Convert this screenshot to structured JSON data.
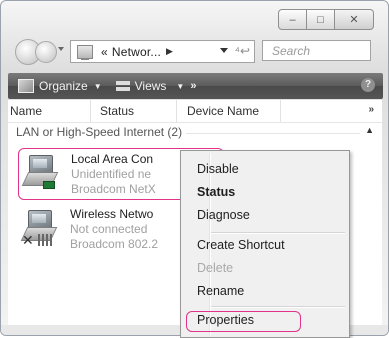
{
  "window": {
    "captions": {
      "minimize": "–",
      "maximize": "□",
      "close": "✕"
    }
  },
  "address_bar": {
    "breadcrumb_prefix": "«",
    "path": "Networ...",
    "path_arrow": "▶",
    "refresh_icon": "refresh-icon"
  },
  "search": {
    "placeholder": "Search"
  },
  "toolbar": {
    "organize_label": "Organize",
    "views_label": "Views",
    "more_label": "»",
    "help_label": "?",
    "bg_color": "#5b5b5b"
  },
  "columns": {
    "name": "Name",
    "status": "Status",
    "device": "Device Name",
    "more": "»"
  },
  "group": {
    "label": "LAN or High-Speed Internet (2)",
    "toggle": "▲"
  },
  "connections": [
    {
      "title": "Local Area Con",
      "status": "Unidentified ne",
      "device": "Broadcom NetX"
    },
    {
      "title": "Wireless Netwo",
      "status": "Not connected",
      "device": "Broadcom 802.2"
    }
  ],
  "context_menu": {
    "disable": "Disable",
    "status": "Status",
    "diagnose": "Diagnose",
    "create_shortcut": "Create Shortcut",
    "delete": "Delete",
    "rename": "Rename",
    "properties": "Properties",
    "highlight_color": "#e2338a"
  }
}
